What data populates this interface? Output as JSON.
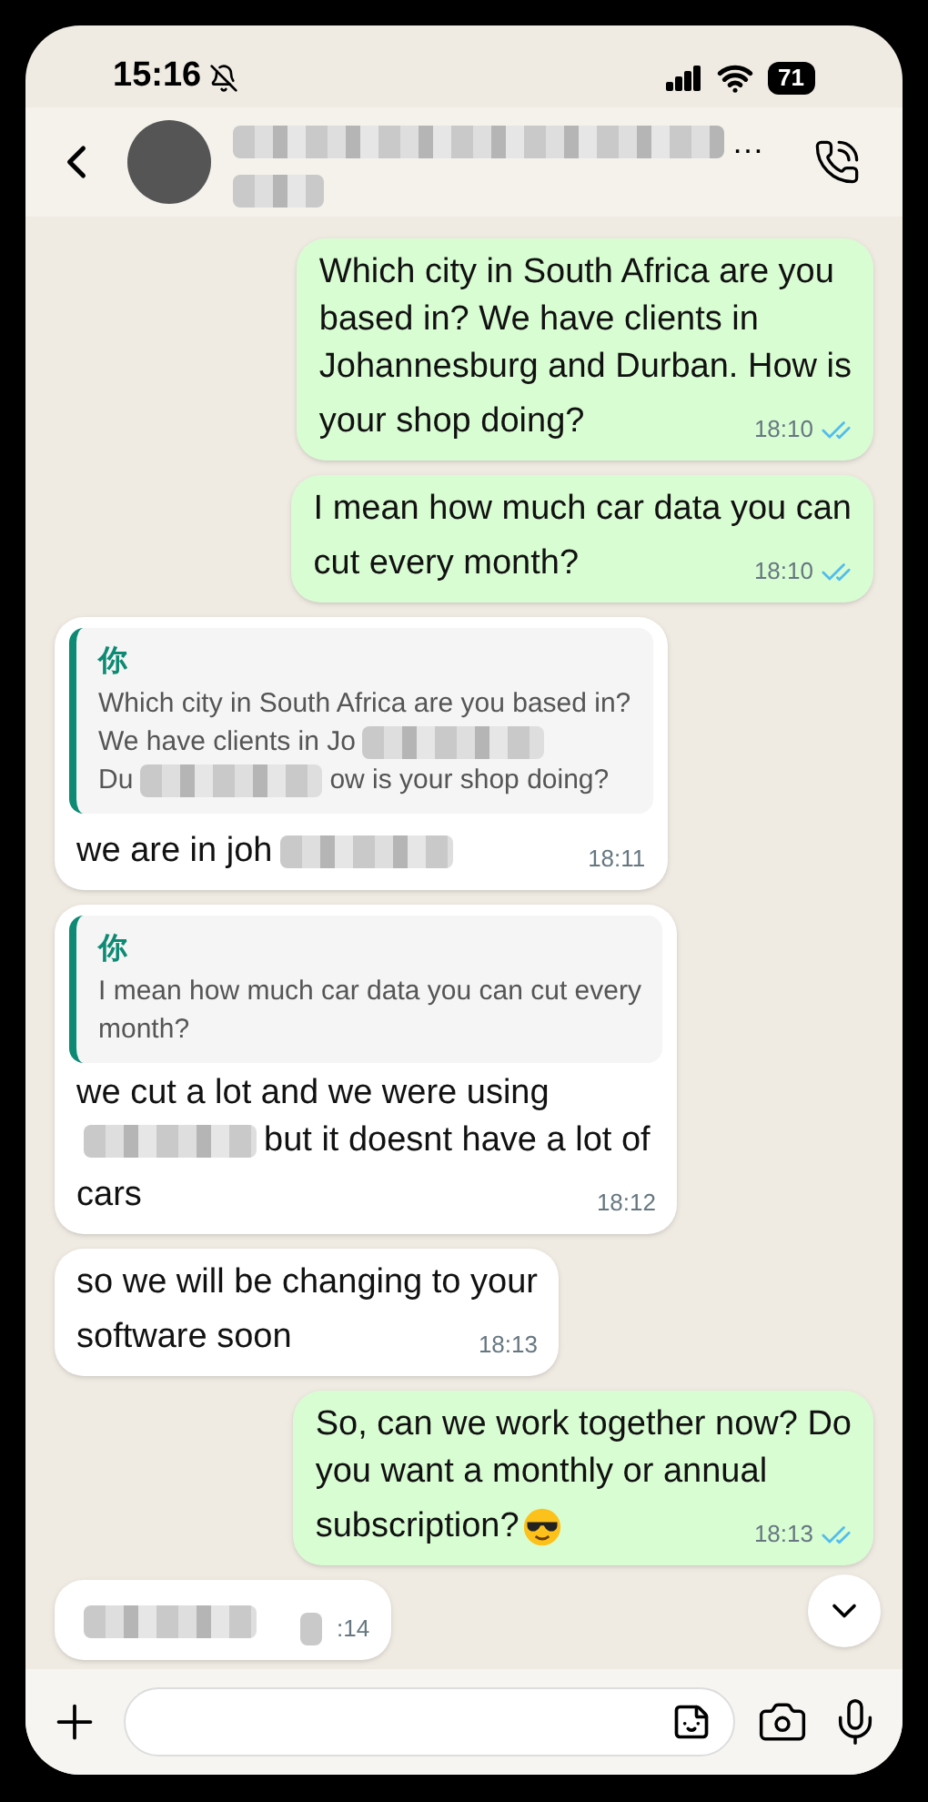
{
  "status_bar": {
    "time": "15:16",
    "muted": true,
    "battery": "71"
  },
  "header": {
    "name_suffix": "…"
  },
  "messages": [
    {
      "kind": "outgoing",
      "lines": [
        [
          {
            "kind": "text",
            "text": "Which city in South Africa are you"
          }
        ],
        [
          {
            "kind": "text",
            "text": "based in? We have clients in"
          }
        ],
        [
          {
            "kind": "text",
            "text": "Johannesburg and Durban. How is"
          }
        ],
        [
          {
            "kind": "text",
            "text": "your shop doing?"
          }
        ]
      ],
      "time": [
        {
          "kind": "text",
          "text": "18:10"
        }
      ],
      "read": true
    },
    {
      "kind": "outgoing",
      "lines": [
        [
          {
            "kind": "text",
            "text": "I mean how much car data you can"
          }
        ],
        [
          {
            "kind": "text",
            "text": "cut every month?"
          }
        ]
      ],
      "time": [
        {
          "kind": "text",
          "text": "18:10"
        }
      ],
      "read": true
    },
    {
      "kind": "incoming",
      "quote": {
        "author": "你",
        "lines": [
          [
            {
              "kind": "text",
              "text": "Which city in South Africa are you based in?"
            }
          ],
          [
            {
              "kind": "text",
              "text": "We have clients in Jo"
            },
            {
              "kind": "blur"
            }
          ],
          [
            {
              "kind": "text",
              "text": "Du"
            },
            {
              "kind": "blur"
            },
            {
              "kind": "text",
              "text": "ow is your shop doing?"
            }
          ]
        ]
      },
      "lines": [
        [
          {
            "kind": "text",
            "text": "we are in joh"
          },
          {
            "kind": "blur"
          }
        ]
      ],
      "time": [
        {
          "kind": "text",
          "text": "18:11"
        }
      ]
    },
    {
      "kind": "incoming",
      "quote": {
        "author": "你",
        "lines": [
          [
            {
              "kind": "text",
              "text": "I mean how much car data you can cut every"
            }
          ],
          [
            {
              "kind": "text",
              "text": "month?"
            }
          ]
        ]
      },
      "lines": [
        [
          {
            "kind": "text",
            "text": "we cut a lot and we were using"
          }
        ],
        [
          {
            "kind": "blur"
          },
          {
            "kind": "text",
            "text": "but it doesnt have a lot of"
          }
        ],
        [
          {
            "kind": "text",
            "text": "cars"
          }
        ]
      ],
      "time": [
        {
          "kind": "text",
          "text": "18:12"
        }
      ]
    },
    {
      "kind": "incoming",
      "lines": [
        [
          {
            "kind": "text",
            "text": "so we will be changing to your"
          }
        ],
        [
          {
            "kind": "text",
            "text": "software soon"
          }
        ]
      ],
      "time": [
        {
          "kind": "text",
          "text": "18:13"
        }
      ]
    },
    {
      "kind": "outgoing",
      "lines": [
        [
          {
            "kind": "text",
            "text": "So, can we work together now? Do"
          }
        ],
        [
          {
            "kind": "text",
            "text": "you want a monthly or annual"
          }
        ],
        [
          {
            "kind": "text",
            "text": "subscription?"
          },
          {
            "kind": "emoji"
          }
        ]
      ],
      "time": [
        {
          "kind": "text",
          "text": "18:13"
        }
      ],
      "read": true
    },
    {
      "kind": "incoming",
      "lines": [
        [
          {
            "kind": "blur"
          }
        ]
      ],
      "time": [
        {
          "kind": "blur"
        },
        {
          "kind": "text",
          "text": ":14"
        }
      ]
    }
  ]
}
